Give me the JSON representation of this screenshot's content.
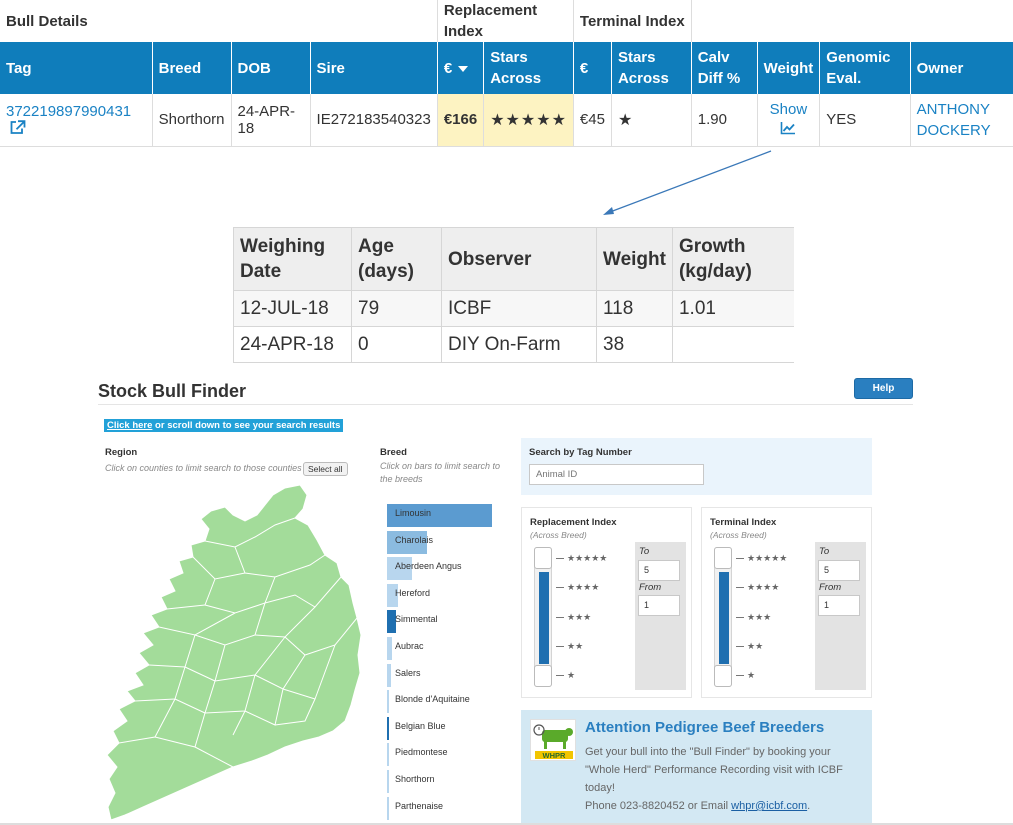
{
  "bull_table": {
    "group_headers": {
      "bull_details": "Bull Details",
      "replacement_index": "Replacement Index",
      "terminal_index": "Terminal Index"
    },
    "columns": {
      "tag": "Tag",
      "breed": "Breed",
      "dob": "DOB",
      "sire": "Sire",
      "repl_euro": "€",
      "repl_stars": "Stars Across",
      "term_euro": "€",
      "term_stars": "Stars Across",
      "calv_diff": "Calv Diff %",
      "weight": "Weight",
      "genomic": "Genomic Eval.",
      "owner": "Owner"
    },
    "row": {
      "tag": "372219897990431",
      "breed": "Shorthorn",
      "dob": "24-APR-18",
      "sire": "IE272183540323",
      "repl_euro": "€166",
      "repl_stars": "★★★★★",
      "term_euro": "€45",
      "term_stars": "★",
      "calv_diff": "1.90",
      "weight_link": "Show",
      "genomic": "YES",
      "owner": "ANTHONY DOCKERY"
    }
  },
  "weighing_table": {
    "headers": {
      "date": "Weighing Date",
      "age": "Age (days)",
      "observer": "Observer",
      "weight": "Weight",
      "growth": "Growth (kg/day)"
    },
    "rows": [
      {
        "date": "12-JUL-18",
        "age": "79",
        "observer": "ICBF",
        "weight": "118",
        "growth": "1.01"
      },
      {
        "date": "24-APR-18",
        "age": "0",
        "observer": "DIY On-Farm",
        "weight": "38",
        "growth": ""
      }
    ]
  },
  "finder": {
    "title": "Stock Bull Finder",
    "help_label": "Help",
    "click_here": "Click here",
    "click_rest": " or scroll down to see your search results",
    "region_label": "Region",
    "region_hint": "Click on counties to limit search to those counties",
    "select_all": "Select all",
    "breed_label": "Breed",
    "breed_hint": "Click on bars to limit search to the breeds",
    "breeds": [
      {
        "name": "Limousin",
        "share": 1.0,
        "level": "lvl1"
      },
      {
        "name": "Charolais",
        "share": 0.38,
        "level": "lvl2"
      },
      {
        "name": "Aberdeen Angus",
        "share": 0.24,
        "level": "lvl3"
      },
      {
        "name": "Hereford",
        "share": 0.1,
        "level": "lvl3"
      },
      {
        "name": "Simmental",
        "share": 0.09,
        "level": "lvl4"
      },
      {
        "name": "Aubrac",
        "share": 0.05,
        "level": "lvl3"
      },
      {
        "name": "Salers",
        "share": 0.04,
        "level": "lvl3"
      },
      {
        "name": "Blonde d'Aquitaine",
        "share": 0.02,
        "level": "lvl3"
      },
      {
        "name": "Belgian Blue",
        "share": 0.02,
        "level": "lvl4"
      },
      {
        "name": "Piedmontese",
        "share": 0.01,
        "level": "lvl3"
      },
      {
        "name": "Shorthorn",
        "share": 0.01,
        "level": "lvl3"
      },
      {
        "name": "Parthenaise",
        "share": 0.01,
        "level": "lvl3"
      }
    ],
    "tag_search_label": "Search by Tag Number",
    "tag_placeholder": "Animal ID",
    "replacement": {
      "title": "Replacement Index",
      "sub": "(Across Breed)",
      "to_label": "To",
      "to_value": "5",
      "from_label": "From",
      "from_value": "1",
      "ticks": [
        "★★★★★",
        "★★★★",
        "★★★",
        "★★",
        "★"
      ]
    },
    "terminal": {
      "title": "Terminal Index",
      "sub": "(Across Breed)",
      "to_label": "To",
      "to_value": "5",
      "from_label": "From",
      "from_value": "1",
      "ticks": [
        "★★★★★",
        "★★★★",
        "★★★",
        "★★",
        "★"
      ]
    },
    "attention": {
      "title": "Attention Pedigree Beef Breeders",
      "body": "Get your bull into the \"Bull Finder\" by booking your \"Whole Herd\" Performance Recording visit with ICBF today!",
      "phone": "Phone 023-8820452 or Email ",
      "email": "whpr@icbf.com",
      "end": ".",
      "logo_text": "WHPR"
    }
  },
  "colors": {
    "header_blue": "#0f7dbb",
    "highlight": "#fdf3c2",
    "map_green": "#a3dc9a",
    "link_blue": "#1a82c4"
  }
}
